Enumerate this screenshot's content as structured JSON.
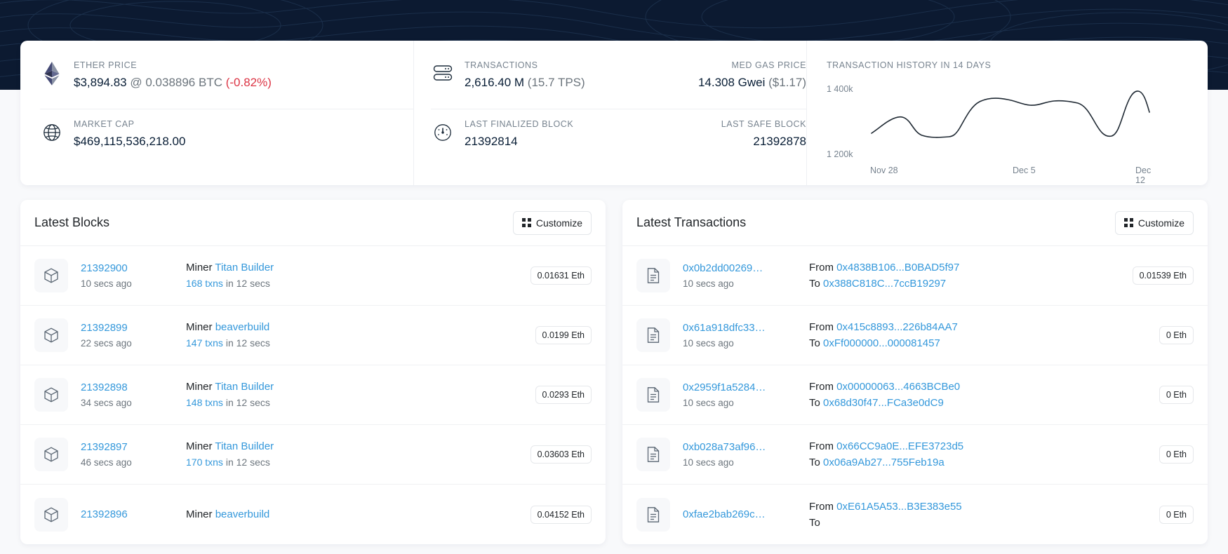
{
  "stats": {
    "ether_price": {
      "label": "ETHER PRICE",
      "icon": "ethereum-icon",
      "price": "$3,894.83",
      "at": "@ 0.038896 BTC",
      "change": "(-0.82%)"
    },
    "market_cap": {
      "label": "MARKET CAP",
      "icon": "globe-icon",
      "value": "$469,115,536,218.00"
    },
    "transactions": {
      "label": "TRANSACTIONS",
      "icon": "server-icon",
      "value": "2,616.40 M",
      "sub": "(15.7 TPS)"
    },
    "med_gas_price": {
      "label": "MED GAS PRICE",
      "value": "14.308 Gwei",
      "sub": "($1.17)"
    },
    "last_finalized_block": {
      "label": "LAST FINALIZED BLOCK",
      "icon": "gauge-icon",
      "value": "21392814"
    },
    "last_safe_block": {
      "label": "LAST SAFE BLOCK",
      "value": "21392878"
    }
  },
  "chart_data": {
    "type": "line",
    "title": "TRANSACTION HISTORY IN 14 DAYS",
    "xlabel": "",
    "ylabel": "",
    "grid": false,
    "legend": null,
    "ytick_labels": [
      "1 400k",
      "1 200k"
    ],
    "ylim": [
      1150000,
      1450000
    ],
    "yticks": [
      1400000,
      1200000
    ],
    "xtick_labels": [
      "Nov 28",
      "Dec 5",
      "Dec 12"
    ],
    "x": [
      "Nov 28",
      "Nov 29",
      "Nov 30",
      "Dec 1",
      "Dec 2",
      "Dec 3",
      "Dec 4",
      "Dec 5",
      "Dec 6",
      "Dec 7",
      "Dec 8",
      "Dec 9",
      "Dec 10",
      "Dec 11",
      "Dec 12"
    ],
    "values": [
      1255000,
      1285000,
      1258000,
      1235000,
      1234000,
      1350000,
      1372000,
      1368000,
      1378000,
      1372000,
      1305000,
      1262000,
      1352000,
      1408000,
      1372000
    ]
  },
  "blocks_panel": {
    "title": "Latest Blocks",
    "customize_label": "Customize",
    "customize_icon": "grid-icon",
    "row_icon": "cube-icon",
    "miner_label": "Miner",
    "in_label": "in 12 secs",
    "rows": [
      {
        "block": "21392900",
        "age": "10 secs ago",
        "miner": "Titan Builder",
        "txns": "168 txns",
        "duration": "in 12 secs",
        "reward": "0.01631 Eth"
      },
      {
        "block": "21392899",
        "age": "22 secs ago",
        "miner": "beaverbuild",
        "txns": "147 txns",
        "duration": "in 12 secs",
        "reward": "0.0199 Eth"
      },
      {
        "block": "21392898",
        "age": "34 secs ago",
        "miner": "Titan Builder",
        "txns": "148 txns",
        "duration": "in 12 secs",
        "reward": "0.0293 Eth"
      },
      {
        "block": "21392897",
        "age": "46 secs ago",
        "miner": "Titan Builder",
        "txns": "170 txns",
        "duration": "in 12 secs",
        "reward": "0.03603 Eth"
      },
      {
        "block": "21392896",
        "age": "",
        "miner": "beaverbuild",
        "txns": "",
        "duration": "",
        "reward": "0.04152 Eth"
      }
    ]
  },
  "transactions_panel": {
    "title": "Latest Transactions",
    "customize_label": "Customize",
    "customize_icon": "grid-icon",
    "row_icon": "document-icon",
    "from_label": "From",
    "to_label": "To",
    "rows": [
      {
        "hash": "0x0b2dd00269…",
        "age": "10 secs ago",
        "from": "0x4838B106...B0BAD5f97",
        "to": "0x388C818C...7ccB19297",
        "value": "0.01539 Eth"
      },
      {
        "hash": "0x61a918dfc33…",
        "age": "10 secs ago",
        "from": "0x415c8893...226b84AA7",
        "to": "0xFf000000...000081457",
        "value": "0 Eth"
      },
      {
        "hash": "0x2959f1a5284…",
        "age": "10 secs ago",
        "from": "0x00000063...4663BCBe0",
        "to": "0x68d30f47...FCa3e0dC9",
        "value": "0 Eth"
      },
      {
        "hash": "0xb028a73af96…",
        "age": "10 secs ago",
        "from": "0x66CC9a0E...EFE3723d5",
        "to": "0x06a9Ab27...755Feb19a",
        "value": "0 Eth"
      },
      {
        "hash": "0xfae2bab269c…",
        "age": "",
        "from": "0xE61A5A53...B3E383e55",
        "to": "",
        "value": "0 Eth"
      }
    ]
  },
  "colors": {
    "link": "#3498db",
    "negative": "#dc3545",
    "muted": "#77838f",
    "dark_hero": "#0c1a31",
    "page_bg": "#f8f9fb"
  }
}
